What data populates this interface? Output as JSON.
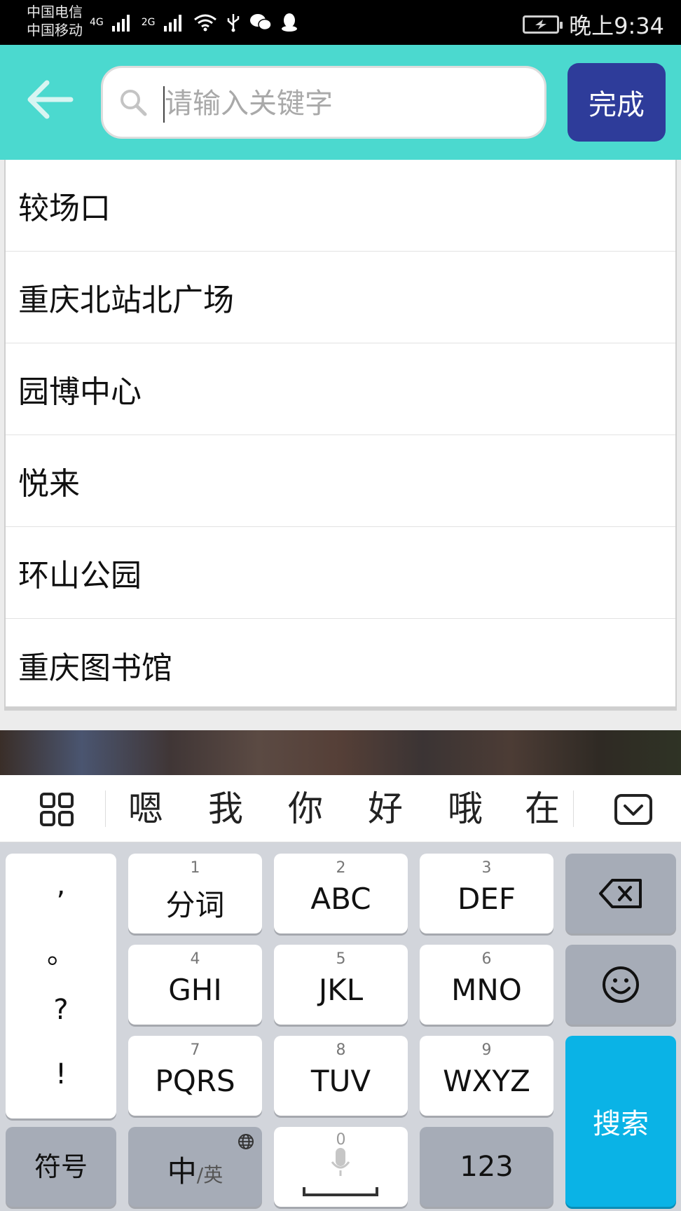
{
  "status_bar": {
    "carrier1": "中国电信",
    "carrier2": "中国移动",
    "net1": "4G",
    "net2": "2G",
    "time": "晚上9:34"
  },
  "header": {
    "search_placeholder": "请输入关键字",
    "done_label": "完成"
  },
  "suggestions": [
    {
      "label": "较场口"
    },
    {
      "label": "重庆北站北广场"
    },
    {
      "label": "园博中心"
    },
    {
      "label": "悦来"
    },
    {
      "label": "环山公园"
    },
    {
      "label": "重庆图书馆"
    }
  ],
  "candidates": [
    "嗯",
    "我",
    "你",
    "好",
    "哦",
    "在"
  ],
  "keyboard": {
    "punct": [
      ",",
      "。",
      "?",
      "!"
    ],
    "keys": [
      {
        "num": "1",
        "label": "分词"
      },
      {
        "num": "2",
        "label": "ABC"
      },
      {
        "num": "3",
        "label": "DEF"
      },
      {
        "num": "4",
        "label": "GHI"
      },
      {
        "num": "5",
        "label": "JKL"
      },
      {
        "num": "6",
        "label": "MNO"
      },
      {
        "num": "7",
        "label": "PQRS"
      },
      {
        "num": "8",
        "label": "TUV"
      },
      {
        "num": "9",
        "label": "WXYZ"
      }
    ],
    "symbols_label": "符号",
    "lang_main": "中",
    "lang_sub": "/英",
    "space_num": "0",
    "num123_label": "123",
    "search_label": "搜索"
  },
  "colors": {
    "header_bg": "#4bd9cf",
    "done_bg": "#2e3c9a",
    "search_key_bg": "#0ab3e6"
  }
}
